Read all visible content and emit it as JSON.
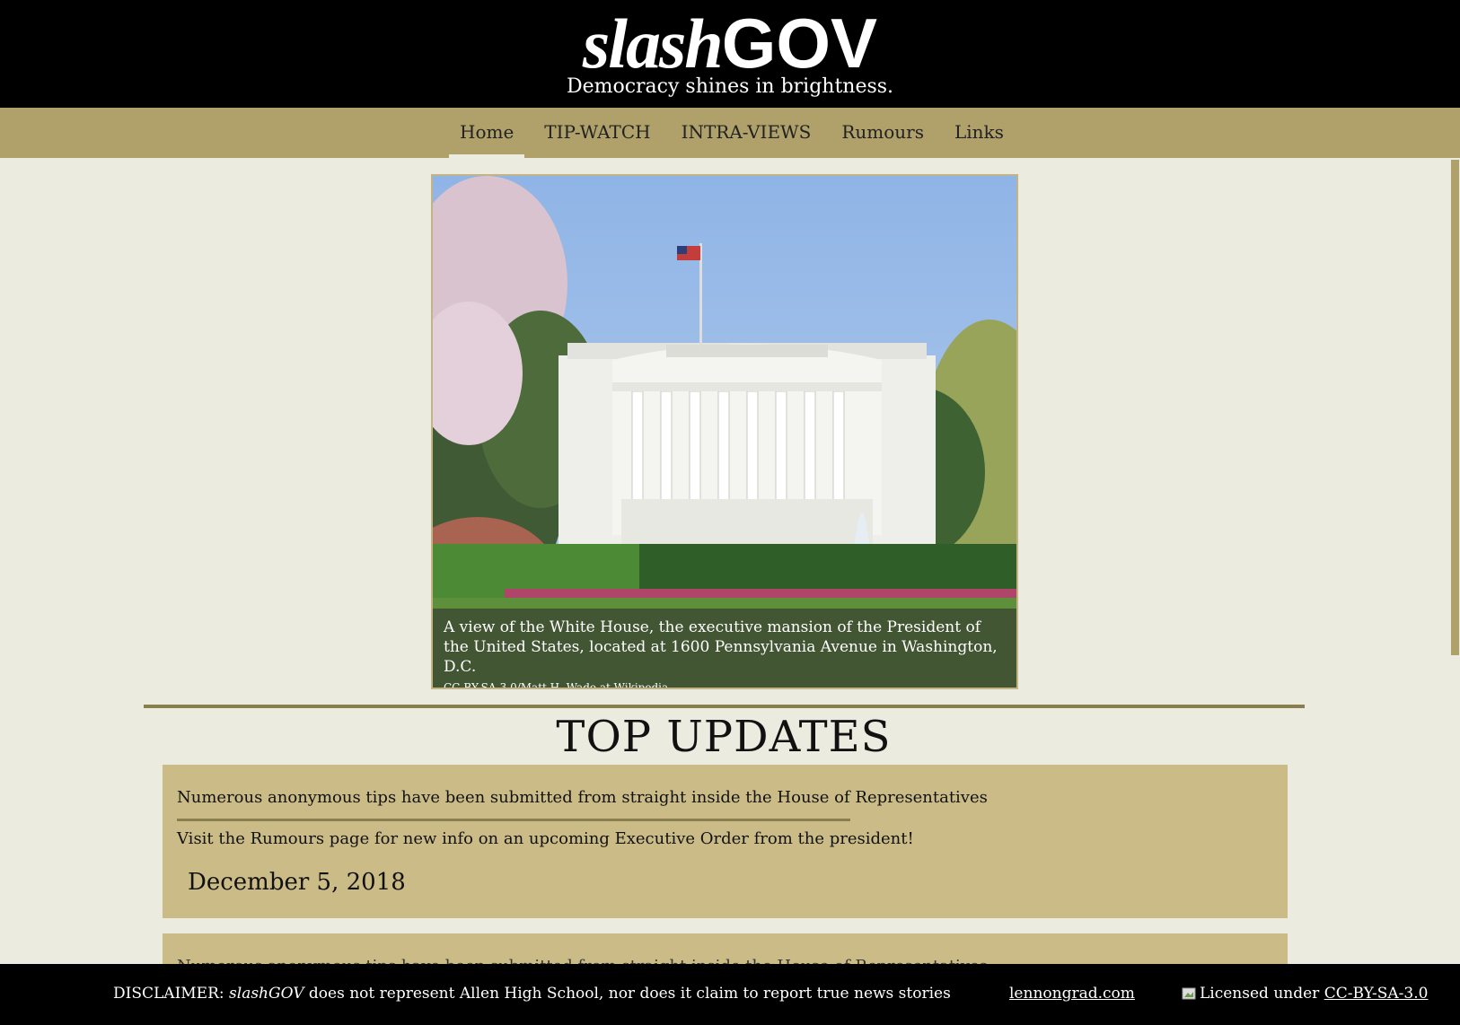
{
  "header": {
    "logo_part1": "slash",
    "logo_part2": "GOV",
    "tagline": "Democracy shines in brightness."
  },
  "nav": {
    "items": [
      {
        "label": "Home",
        "active": true
      },
      {
        "label": "TIP-WATCH"
      },
      {
        "label": "INTRA-VIEWS"
      },
      {
        "label": "Rumours"
      },
      {
        "label": "Links"
      }
    ]
  },
  "hero": {
    "caption": "A view of the White House, the executive mansion of the President of the United States, located at 1600 Pennsylvania Avenue in Washington, D.C.",
    "credit_license": "CC-BY-SA-3.0",
    "credit_separator": "/",
    "credit_author": "Matt H. Wade",
    "credit_suffix": " at Wikipedia"
  },
  "top_updates": {
    "title": "TOP UPDATES",
    "cards": [
      {
        "line1": "Numerous anonymous tips have been submitted from straight inside the House of Representatives",
        "line2": "Visit the Rumours page for new info on an upcoming Executive Order from the president!",
        "date": "December 5, 2018"
      },
      {
        "line1": "Numerous anonymous tips have been submitted from straight inside the House of Representatives"
      }
    ]
  },
  "footer": {
    "disclaimer_prefix": "DISCLAIMER: ",
    "disclaimer_brand": "slashGOV",
    "disclaimer_rest": " does not represent Allen High School, nor does it claim to report true news stories",
    "site_link": "lennongrad.com",
    "license_prefix": "Licensed under ",
    "license_link": "CC-BY-SA-3.0"
  },
  "colors": {
    "header_bg": "#000000",
    "nav_bg": "#b0a06a",
    "page_bg": "#ecebe0",
    "card_bg": "#cbbc87",
    "accent_rule": "#8a7d4e"
  }
}
